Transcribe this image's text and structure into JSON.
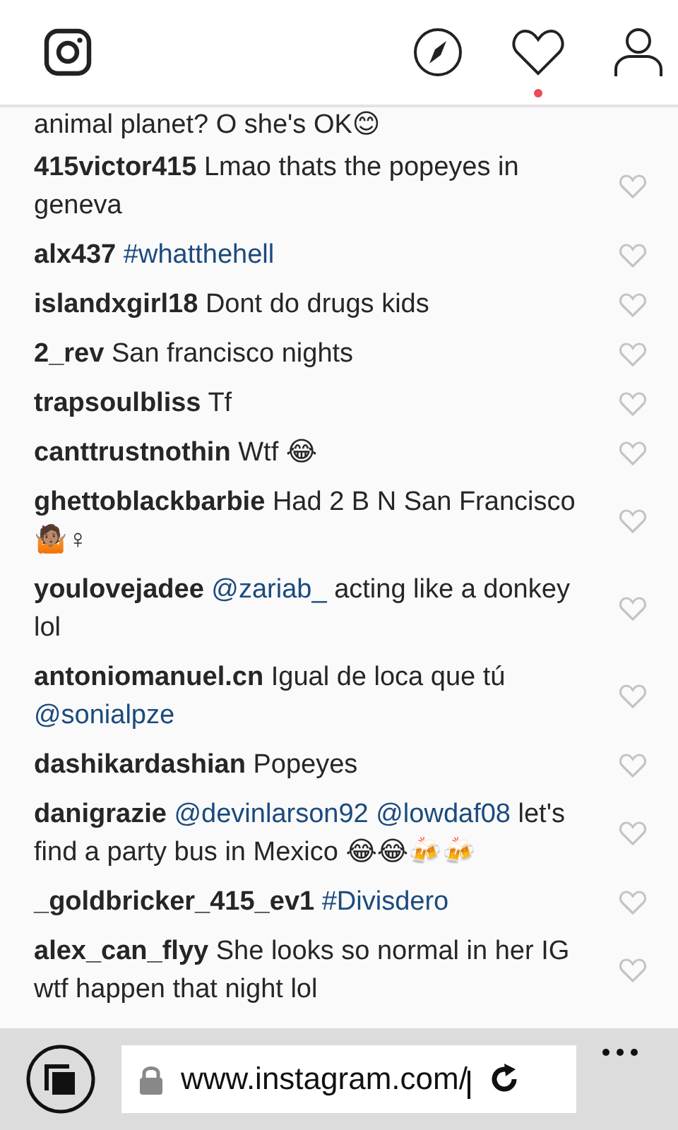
{
  "header": {
    "has_notification": true
  },
  "partial_comment": "animal planet? O she's OK😊",
  "comments": [
    {
      "user": "415victor415",
      "liked": false,
      "segments": [
        {
          "kind": "plain",
          "text": "Lmao thats the popeyes in geneva"
        }
      ]
    },
    {
      "user": "alx437",
      "liked": false,
      "segments": [
        {
          "kind": "mention",
          "text": "#whatthehell"
        }
      ]
    },
    {
      "user": "islandxgirl18",
      "liked": false,
      "segments": [
        {
          "kind": "plain",
          "text": "Dont do drugs kids"
        }
      ]
    },
    {
      "user": "2_rev",
      "liked": false,
      "segments": [
        {
          "kind": "plain",
          "text": "San francisco nights"
        }
      ]
    },
    {
      "user": "trapsoulbliss",
      "liked": false,
      "segments": [
        {
          "kind": "plain",
          "text": "Tf"
        }
      ]
    },
    {
      "user": "canttrustnothin",
      "liked": false,
      "segments": [
        {
          "kind": "plain",
          "text": "Wtf 😂"
        }
      ]
    },
    {
      "user": "ghettoblackbarbie",
      "liked": false,
      "segments": [
        {
          "kind": "plain",
          "text": "Had 2 B N San Francisco 🤷🏽♀"
        }
      ]
    },
    {
      "user": "youlovejadee",
      "liked": false,
      "segments": [
        {
          "kind": "mention",
          "text": "@zariab_"
        },
        {
          "kind": "plain",
          "text": "acting like a donkey lol"
        }
      ]
    },
    {
      "user": "antoniomanuel.cn",
      "liked": false,
      "segments": [
        {
          "kind": "plain",
          "text": "Igual de loca que tú"
        },
        {
          "kind": "mention",
          "text": "@sonialpze"
        }
      ]
    },
    {
      "user": "dashikardashian",
      "liked": false,
      "segments": [
        {
          "kind": "plain",
          "text": "Popeyes"
        }
      ]
    },
    {
      "user": "danigrazie",
      "liked": false,
      "segments": [
        {
          "kind": "mention",
          "text": "@devinlarson92"
        },
        {
          "kind": "mention",
          "text": "@lowdaf08"
        },
        {
          "kind": "plain",
          "text": "let's find a party bus in Mexico 😂😂🍻🍻"
        }
      ]
    },
    {
      "user": "_goldbricker_415_ev1",
      "liked": false,
      "segments": [
        {
          "kind": "mention",
          "text": "#Divisdero"
        }
      ]
    },
    {
      "user": "alex_can_flyy",
      "liked": false,
      "segments": [
        {
          "kind": "plain",
          "text": "She looks so normal in her IG wtf happen that night lol"
        }
      ]
    }
  ],
  "address_bar": {
    "url": "www.instagram.com/"
  }
}
